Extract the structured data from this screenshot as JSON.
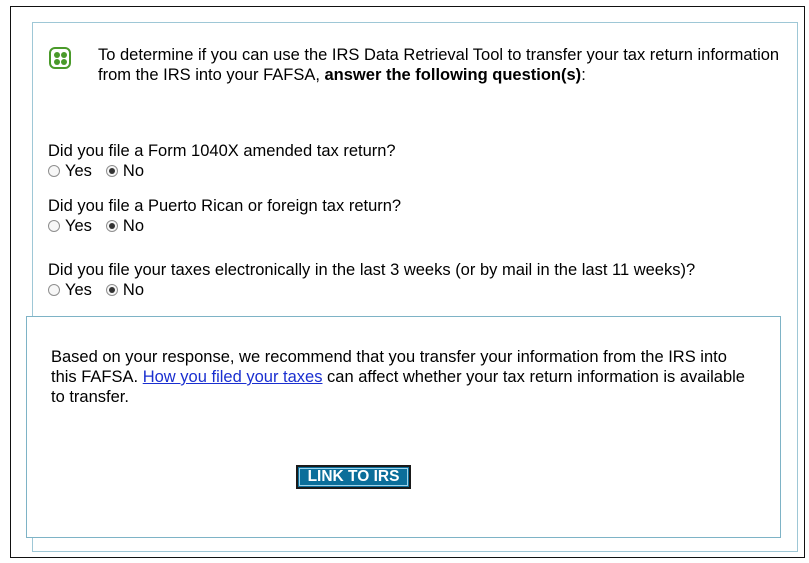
{
  "intro": {
    "text_start": "To determine if you can use the IRS Data Retrieval Tool to transfer your tax return information from the IRS into your FAFSA, ",
    "text_bold": "answer the following question(s)",
    "text_end": ":"
  },
  "questions": [
    {
      "text": "Did you file a Form 1040X amended tax return?",
      "options": [
        "Yes",
        "No"
      ],
      "selected": "No"
    },
    {
      "text": "Did you file a Puerto Rican or foreign tax return?",
      "options": [
        "Yes",
        "No"
      ],
      "selected": "No"
    },
    {
      "text": "Did you file your taxes electronically in the last 3 weeks (or by mail in the last 11 weeks)?",
      "options": [
        "Yes",
        "No"
      ],
      "selected": "No"
    }
  ],
  "recommendation": {
    "text_before": "Based on your response, we recommend that you transfer your information from the IRS into this FAFSA. ",
    "link_text": "How you filed your taxes",
    "text_after": " can affect whether your tax return information is available to transfer.",
    "button_label": "LINK TO IRS"
  },
  "colors": {
    "icon_green": "#4a9a2a",
    "panel_border": "#9ec7d6",
    "button_bg": "#0b6e9a",
    "link": "#1a2fd0"
  },
  "icons": {
    "intro": "info-dots-icon"
  }
}
